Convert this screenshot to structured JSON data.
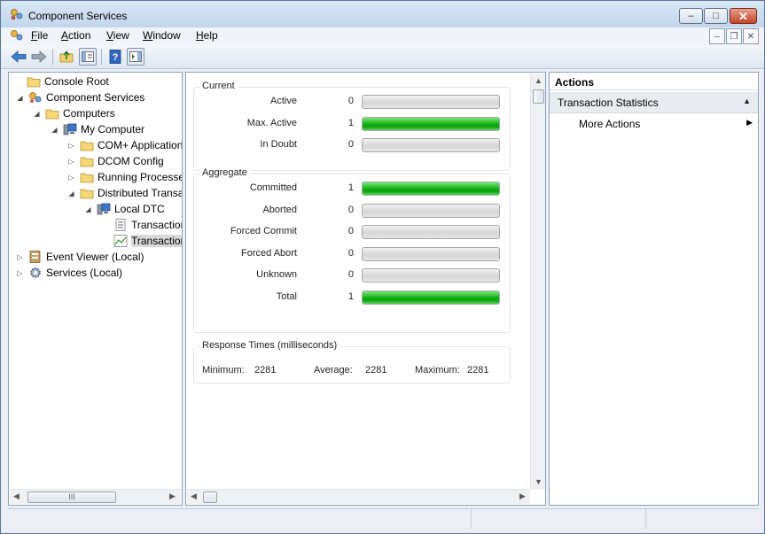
{
  "window": {
    "title": "Component Services"
  },
  "titlebar_buttons": {
    "minimize_glyph": "–",
    "maximize_glyph": "□",
    "close_glyph": "✕"
  },
  "menu": {
    "items": [
      {
        "accel": "F",
        "rest": "ile"
      },
      {
        "accel": "A",
        "rest": "ction"
      },
      {
        "accel": "V",
        "rest": "iew"
      },
      {
        "accel": "W",
        "rest": "indow"
      },
      {
        "accel": "H",
        "rest": "elp"
      }
    ],
    "child_minimize_glyph": "–",
    "child_restore_glyph": "❐",
    "child_close_glyph": "✕"
  },
  "toolbar": {
    "icons": [
      "back-icon",
      "forward-icon",
      "up-folder-icon",
      "show-hide-tree-icon",
      "help-icon",
      "show-hide-action-pane-icon"
    ]
  },
  "tree": {
    "items": [
      {
        "label": "Console Root",
        "icon": "folder-icon",
        "expander": ""
      },
      {
        "label": "Component Services",
        "icon": "component-services-icon",
        "expander": "◢"
      },
      {
        "label": "Computers",
        "icon": "folder-icon",
        "expander": "◢"
      },
      {
        "label": "My Computer",
        "icon": "computer-icon",
        "expander": "◢"
      },
      {
        "label": "COM+ Applications",
        "icon": "folder-icon",
        "expander": "▷"
      },
      {
        "label": "DCOM Config",
        "icon": "folder-icon",
        "expander": "▷"
      },
      {
        "label": "Running Processes",
        "icon": "folder-icon",
        "expander": "▷"
      },
      {
        "label": "Distributed Transaction Coordinator",
        "icon": "folder-icon",
        "expander": "◢"
      },
      {
        "label": "Local DTC",
        "icon": "computer-icon",
        "expander": "◢"
      },
      {
        "label": "Transaction List",
        "icon": "list-icon",
        "expander": ""
      },
      {
        "label": "Transaction Statistics",
        "icon": "chart-icon",
        "expander": ""
      },
      {
        "label": "Event Viewer (Local)",
        "icon": "event-viewer-icon",
        "expander": "▷"
      },
      {
        "label": "Services (Local)",
        "icon": "gear-icon",
        "expander": "▷"
      }
    ],
    "scroll_thumb_glyph": "III",
    "scroll_left_glyph": "◀",
    "scroll_right_glyph": "▶"
  },
  "stats": {
    "current": {
      "title": "Current",
      "rows": [
        {
          "label": "Active",
          "value": "0",
          "fill": 0
        },
        {
          "label": "Max. Active",
          "value": "1",
          "fill": 1
        },
        {
          "label": "In Doubt",
          "value": "0",
          "fill": 0
        }
      ]
    },
    "aggregate": {
      "title": "Aggregate",
      "rows": [
        {
          "label": "Committed",
          "value": "1",
          "fill": 1
        },
        {
          "label": "Aborted",
          "value": "0",
          "fill": 0
        },
        {
          "label": "Forced Commit",
          "value": "0",
          "fill": 0
        },
        {
          "label": "Forced Abort",
          "value": "0",
          "fill": 0
        },
        {
          "label": "Unknown",
          "value": "0",
          "fill": 0
        },
        {
          "label": "Total",
          "value": "1",
          "fill": 1
        }
      ]
    },
    "response": {
      "title": "Response Times (milliseconds)",
      "minimum_label": "Minimum:",
      "minimum_value": "2281",
      "average_label": "Average:",
      "average_value": "2281",
      "maximum_label": "Maximum:",
      "maximum_value": "2281"
    },
    "scroll_up_glyph": "▲",
    "scroll_down_glyph": "▼",
    "scroll_left_glyph": "◀",
    "scroll_right_glyph": "▶"
  },
  "actions": {
    "header": "Actions",
    "section": "Transaction Statistics",
    "section_caret": "▲",
    "item": "More Actions",
    "item_arrow": "▶"
  },
  "colors": {
    "bar_fill": "#13b213",
    "bar_empty": "#d5d5d5",
    "window_frame": "#c7d8ec"
  }
}
